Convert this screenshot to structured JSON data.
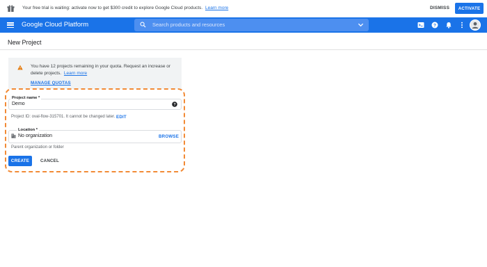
{
  "promo": {
    "message": "Your free trial is waiting: activate now to get $300 credit to explore Google Cloud products.",
    "learn_more": "Learn more",
    "dismiss": "DISMISS",
    "activate": "ACTIVATE"
  },
  "appbar": {
    "brand": "Google Cloud Platform",
    "search_placeholder": "Search products and resources"
  },
  "page": {
    "title": "New Project"
  },
  "notice": {
    "message": "You have 12 projects remaining in your quota. Request an increase or delete projects.",
    "learn_more": "Learn more",
    "manage_quotas": "MANAGE QUOTAS"
  },
  "form": {
    "project_name_label": "Project name *",
    "project_name_value": "Demo",
    "project_id_hint": "Project ID: oval-flow-315701. It cannot be changed later.",
    "edit": "EDIT",
    "location_label": "Location *",
    "location_value": "No organization",
    "browse": "BROWSE",
    "location_hint": "Parent organization or folder",
    "create": "CREATE",
    "cancel": "CANCEL"
  },
  "colors": {
    "primary": "#1a73e8",
    "highlight": "#f28a35",
    "notice_bg": "#f1f3f4"
  }
}
